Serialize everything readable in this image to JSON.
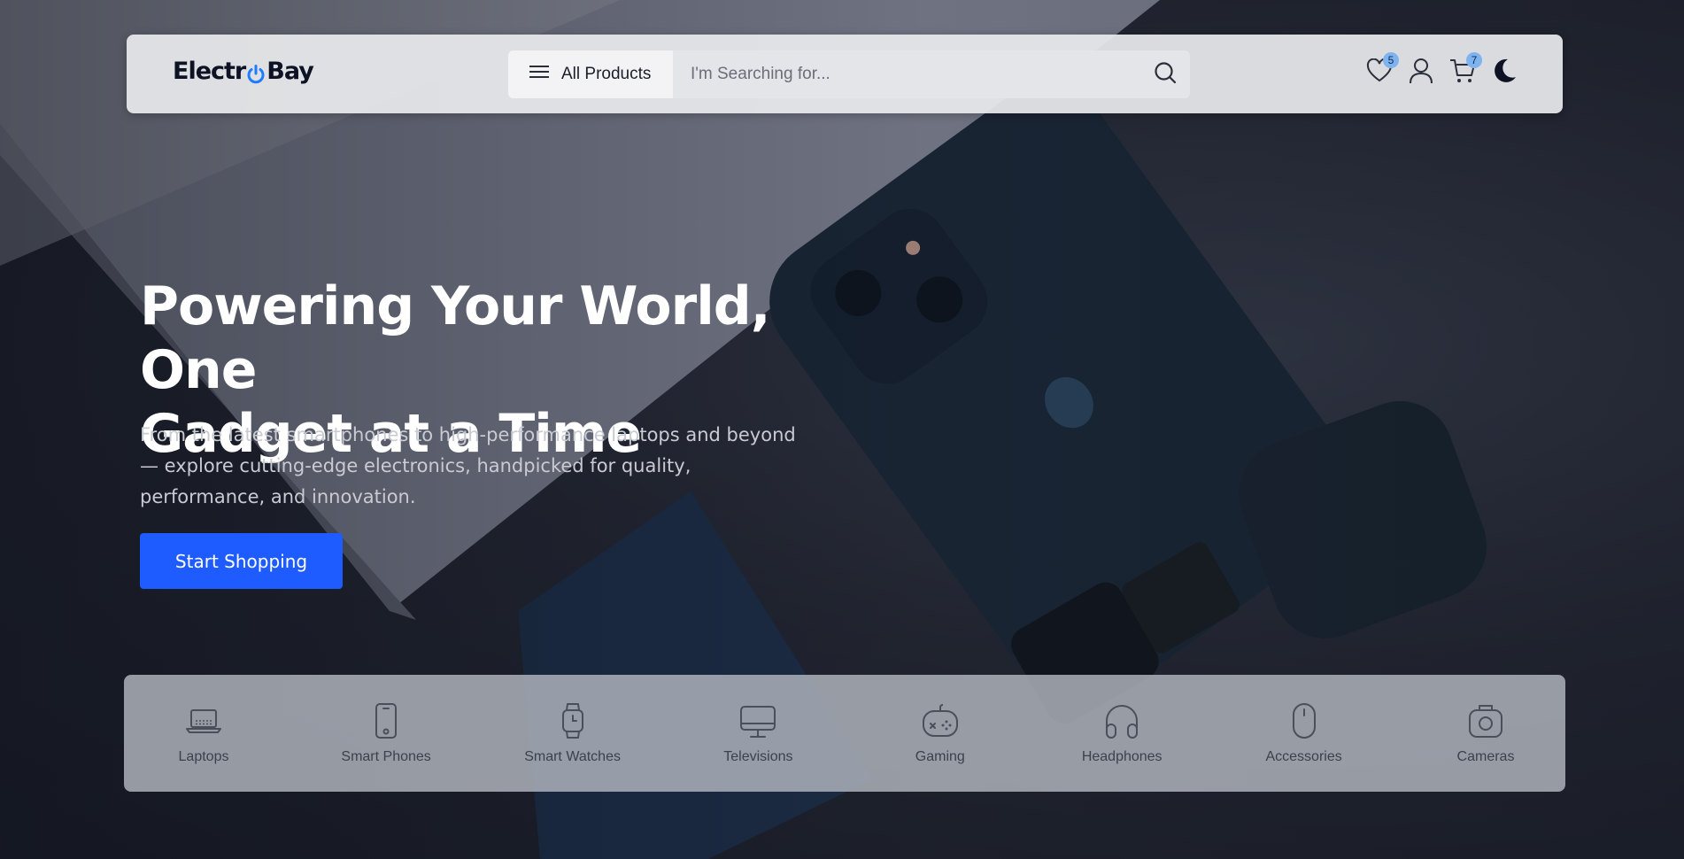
{
  "brand": {
    "name_part1": "Electr",
    "name_part2": "Bay",
    "accent": "#1f5cff"
  },
  "header": {
    "all_products_label": "All Products",
    "search_placeholder": "I'm Searching for...",
    "wishlist_count": "5",
    "cart_count": "7",
    "icons": [
      "menu-icon",
      "search-icon",
      "heart-icon",
      "user-icon",
      "cart-icon",
      "moon-icon"
    ]
  },
  "hero": {
    "title_line1": "Powering Your World, One",
    "title_line2": "Gadget at a Time",
    "subtitle_line1": "From the latest smartphones to high-performance laptops and beyond",
    "subtitle_line2": "— explore cutting-edge electronics, handpicked for quality,",
    "subtitle_line3": "performance, and innovation.",
    "cta_label": "Start Shopping"
  },
  "categories": [
    {
      "label": "Laptops",
      "icon": "laptop-icon"
    },
    {
      "label": "Smart Phones",
      "icon": "smartphone-icon"
    },
    {
      "label": "Smart Watches",
      "icon": "smartwatch-icon"
    },
    {
      "label": "Televisions",
      "icon": "television-icon"
    },
    {
      "label": "Gaming",
      "icon": "gamepad-icon"
    },
    {
      "label": "Headphones",
      "icon": "headphones-icon"
    },
    {
      "label": "Accessories",
      "icon": "mouse-icon"
    },
    {
      "label": "Cameras",
      "icon": "camera-icon"
    }
  ]
}
